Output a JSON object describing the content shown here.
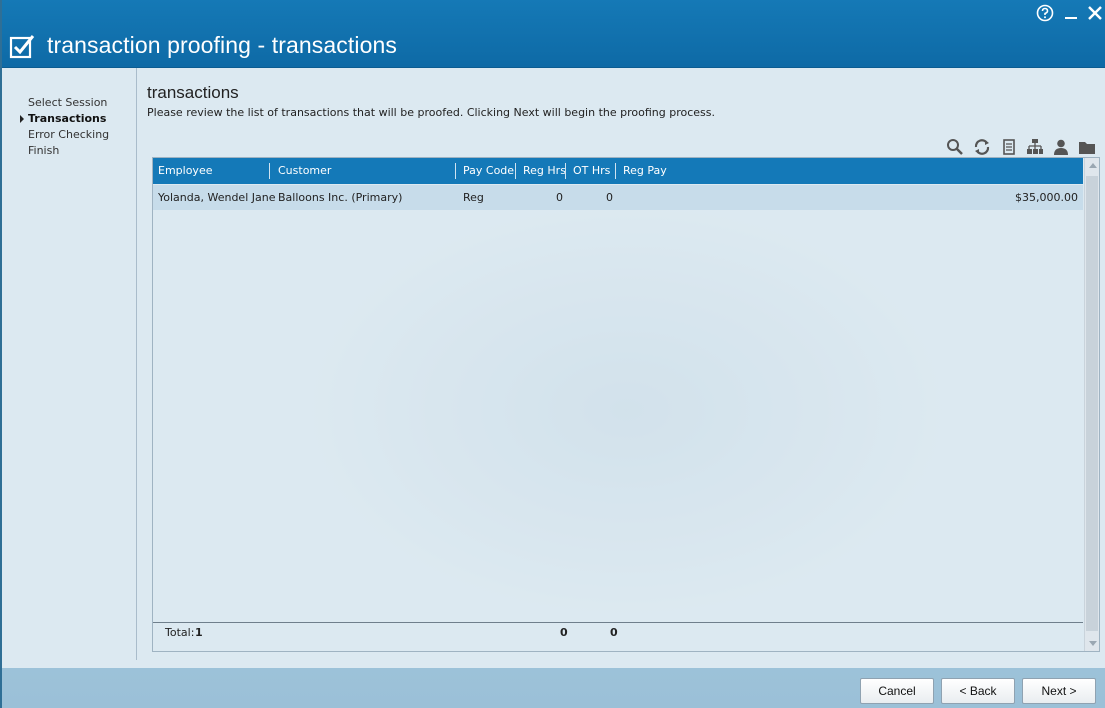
{
  "window": {
    "title": "transaction proofing - transactions"
  },
  "nav": {
    "items": [
      {
        "label": "Select Session",
        "active": false
      },
      {
        "label": "Transactions",
        "active": true
      },
      {
        "label": "Error Checking",
        "active": false
      },
      {
        "label": "Finish",
        "active": false
      }
    ]
  },
  "main": {
    "heading": "transactions",
    "description": "Please review the list of transactions that will be proofed.  Clicking Next will begin the proofing process."
  },
  "toolbar": {
    "icons": [
      "search-icon",
      "refresh-icon",
      "report-icon",
      "org-chart-icon",
      "person-icon",
      "folder-icon"
    ]
  },
  "table": {
    "columns": [
      "Employee",
      "Customer",
      "Pay Code",
      "Reg Hrs",
      "OT Hrs",
      "Reg Pay"
    ],
    "rows": [
      {
        "employee": "Yolanda, Wendel Jane",
        "customer": "Balloons Inc. (Primary)",
        "pay_code": "Reg",
        "reg_hrs": "0",
        "ot_hrs": "0",
        "reg_pay": "$35,000.00"
      }
    ],
    "footer": {
      "total_label": "Total:",
      "total_count": "1",
      "reg_hrs_total": "0",
      "ot_hrs_total": "0"
    }
  },
  "buttons": {
    "cancel": "Cancel",
    "back": "< Back",
    "next": "Next >"
  },
  "colors": {
    "header_blue": "#1479b8",
    "row_highlight": "#c7dcea",
    "background": "#dce9f1"
  }
}
